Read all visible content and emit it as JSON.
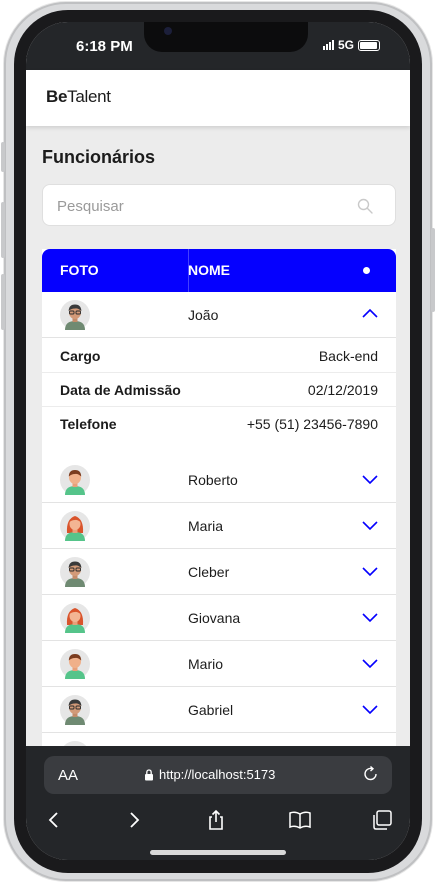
{
  "status": {
    "time": "6:18 PM",
    "network": "5G"
  },
  "app": {
    "brand_bold": "Be",
    "brand_rest": "Talent"
  },
  "page": {
    "title": "Funcionários"
  },
  "search": {
    "placeholder": "Pesquisar",
    "value": ""
  },
  "table": {
    "headers": {
      "photo": "FOTO",
      "name": "NOME"
    },
    "accent_color": "#0500ff",
    "rows": [
      {
        "name": "João",
        "expanded": true,
        "avatar": "man-glasses-avatar-icon"
      },
      {
        "name": "Roberto",
        "expanded": false,
        "avatar": "man-avatar-icon"
      },
      {
        "name": "Maria",
        "expanded": false,
        "avatar": "woman-avatar-icon"
      },
      {
        "name": "Cleber",
        "expanded": false,
        "avatar": "man-glasses-avatar-icon"
      },
      {
        "name": "Giovana",
        "expanded": false,
        "avatar": "woman-avatar-icon"
      },
      {
        "name": "Mario",
        "expanded": false,
        "avatar": "man-avatar-icon"
      },
      {
        "name": "Gabriel",
        "expanded": false,
        "avatar": "man-glasses-avatar-icon"
      }
    ],
    "details": {
      "role_label": "Cargo",
      "role_value": "Back-end",
      "admission_label": "Data de Admissão",
      "admission_value": "02/12/2019",
      "phone_label": "Telefone",
      "phone_value": "+55 (51) 23456-7890"
    }
  },
  "browser": {
    "text_size_label": "AA",
    "url": "http://localhost:5173"
  }
}
